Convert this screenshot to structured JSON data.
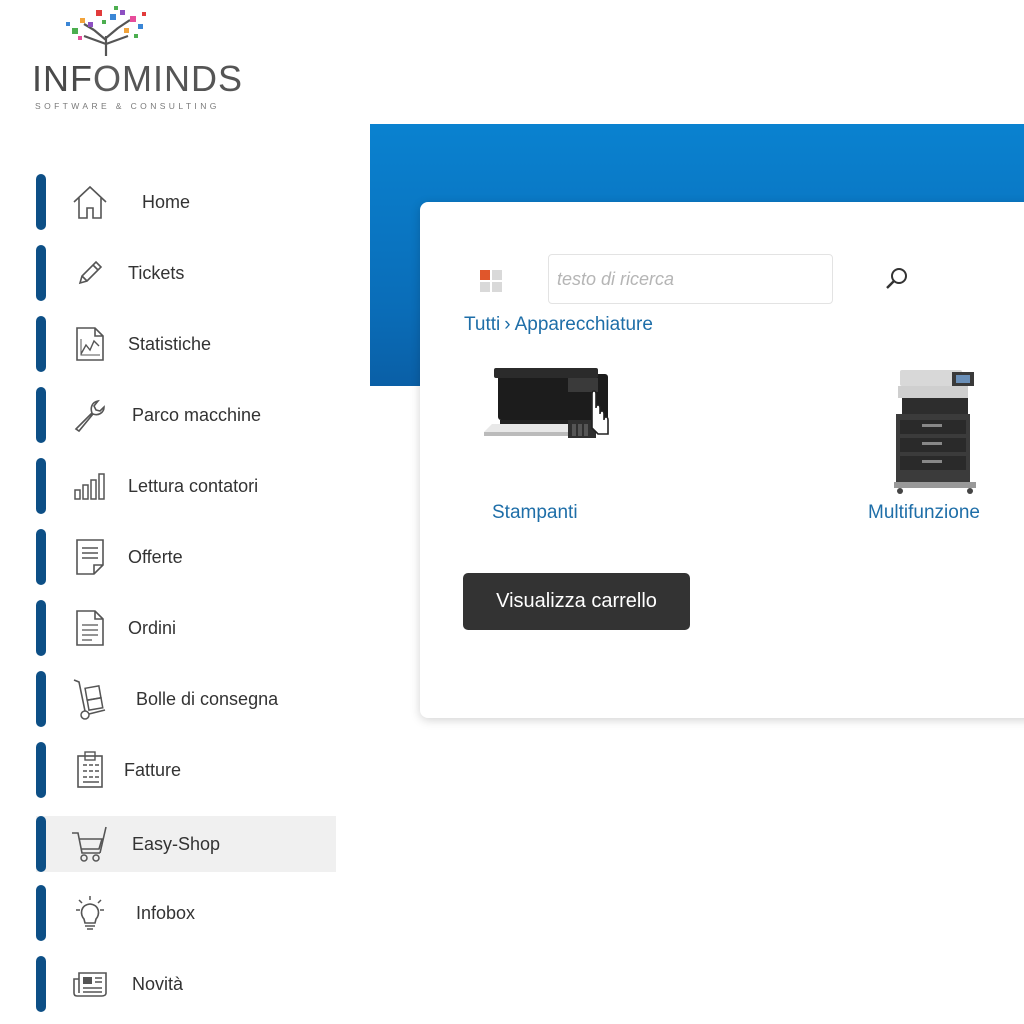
{
  "brand": {
    "name_part1": "INF",
    "name_part2": "O",
    "name_part3": "MINDS",
    "tagline": "SOFTWARE & CONSULTING"
  },
  "sidebar": {
    "items": [
      {
        "label": "Home",
        "icon": "home-icon"
      },
      {
        "label": "Tickets",
        "icon": "pencil-icon"
      },
      {
        "label": "Statistiche",
        "icon": "chart-document-icon"
      },
      {
        "label": "Parco macchine",
        "icon": "wrench-icon"
      },
      {
        "label": "Lettura contatori",
        "icon": "bar-chart-icon"
      },
      {
        "label": "Offerte",
        "icon": "document-icon"
      },
      {
        "label": "Ordini",
        "icon": "list-document-icon"
      },
      {
        "label": "Bolle di consegna",
        "icon": "hand-truck-icon"
      },
      {
        "label": "Fatture",
        "icon": "invoice-icon"
      },
      {
        "label": "Easy-Shop",
        "icon": "cart-icon",
        "active": true
      },
      {
        "label": "Infobox",
        "icon": "lightbulb-icon"
      },
      {
        "label": "Novità",
        "icon": "newspaper-icon"
      }
    ],
    "accent_color": "#0d4f86"
  },
  "shop": {
    "search_placeholder": "testo di ricerca",
    "breadcrumb": {
      "root": "Tutti",
      "separator": "›",
      "current": "Apparecchiature"
    },
    "products": [
      {
        "name": "Stampanti",
        "icon": "printer-icon"
      },
      {
        "name": "Multifunzione",
        "icon": "multifunction-printer-icon"
      }
    ],
    "cart_button": "Visualizza carrello"
  },
  "colors": {
    "hero_blue": "#0a82d0",
    "link_blue": "#1e6ea8",
    "button_dark": "#333333"
  }
}
